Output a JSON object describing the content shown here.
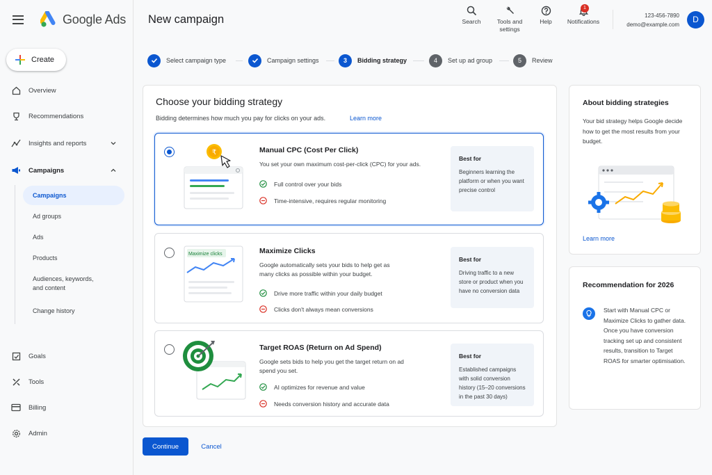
{
  "app": {
    "name": "Google Ads"
  },
  "sidebar": {
    "create_label": "Create",
    "items": [
      {
        "label": "Overview",
        "icon": "home-icon"
      },
      {
        "label": "Recommendations",
        "icon": "trophy-icon"
      },
      {
        "label": "Insights and reports",
        "icon": "insights-icon"
      },
      {
        "label": "Campaigns",
        "icon": "megaphone-icon"
      },
      {
        "label": "Goals",
        "icon": "goals-icon"
      },
      {
        "label": "Tools",
        "icon": "tools-icon"
      },
      {
        "label": "Billing",
        "icon": "billing-icon"
      },
      {
        "label": "Admin",
        "icon": "gear-icon"
      }
    ],
    "campaign_sub": [
      {
        "label": "Campaigns",
        "active": true
      },
      {
        "label": "Ad groups"
      },
      {
        "label": "Ads"
      },
      {
        "label": "Products"
      },
      {
        "label": "Audiences, keywords, and content"
      },
      {
        "label": "Change history"
      }
    ]
  },
  "header": {
    "title": "New campaign",
    "tools": [
      {
        "label": "Search",
        "icon": "search-icon"
      },
      {
        "label": "Tools and settings",
        "icon": "wrench-icon"
      },
      {
        "label": "Help",
        "icon": "help-icon"
      },
      {
        "label": "Notifications",
        "icon": "bell-icon",
        "badge": "1"
      }
    ],
    "account_id": "123-456-7890",
    "account_email": "demo@example.com",
    "avatar_letter": "D"
  },
  "steps": [
    {
      "label": "Select campaign type",
      "state": "done"
    },
    {
      "label": "Campaign settings",
      "state": "done"
    },
    {
      "label": "Bidding strategy",
      "state": "current",
      "num": "3"
    },
    {
      "label": "Set up ad group",
      "state": "todo",
      "num": "4"
    },
    {
      "label": "Review",
      "state": "todo",
      "num": "5"
    }
  ],
  "main": {
    "title": "Choose your bidding strategy",
    "subtitle": "Bidding determines how much you pay for clicks on your ads.",
    "learn_more": "Learn more",
    "options": [
      {
        "title": "Manual CPC (Cost Per Click)",
        "desc": "You set your own maximum cost-per-click (CPC) for your ads.",
        "pro": "Full control over your bids",
        "con": "Time-intensive, requires regular monitoring",
        "best_for_title": "Best for",
        "best_for": "Beginners learning the platform or when you want precise control",
        "selected": true,
        "coin_symbol": "₹"
      },
      {
        "title": "Maximize Clicks",
        "desc": "Google automatically sets your bids to help get as many clicks as possible within your budget.",
        "pro": "Drive more traffic within your daily budget",
        "con": "Clicks don't always mean conversions",
        "best_for_title": "Best for",
        "best_for": "Driving traffic to a new store or product when you have no conversion data",
        "selected": false,
        "illus_label": "Maximize clicks"
      },
      {
        "title": "Target ROAS (Return on Ad Spend)",
        "desc": "Google sets bids to help you get the target return on ad spend you set.",
        "pro": "AI optimizes for revenue and value",
        "con": "Needs conversion history and accurate data",
        "best_for_title": "Best for",
        "best_for": "Established campaigns with solid conversion history (15–20 conversions in the past 30 days)",
        "selected": false
      }
    ]
  },
  "about": {
    "title": "About bidding strategies",
    "text": "Your bid strategy helps Google decide how to get the most results from your budget.",
    "learn_more": "Learn more"
  },
  "recommendation": {
    "title": "Recommendation for 2026",
    "text": "Start with Manual CPC or Maximize Clicks to gather data. Once you have conversion tracking set up and consistent results, transition to Target ROAS for smarter optimisation."
  },
  "actions": {
    "continue": "Continue",
    "cancel": "Cancel"
  },
  "colors": {
    "primary": "#0b57d0",
    "success": "#1e8e3e",
    "error": "#d93025"
  }
}
